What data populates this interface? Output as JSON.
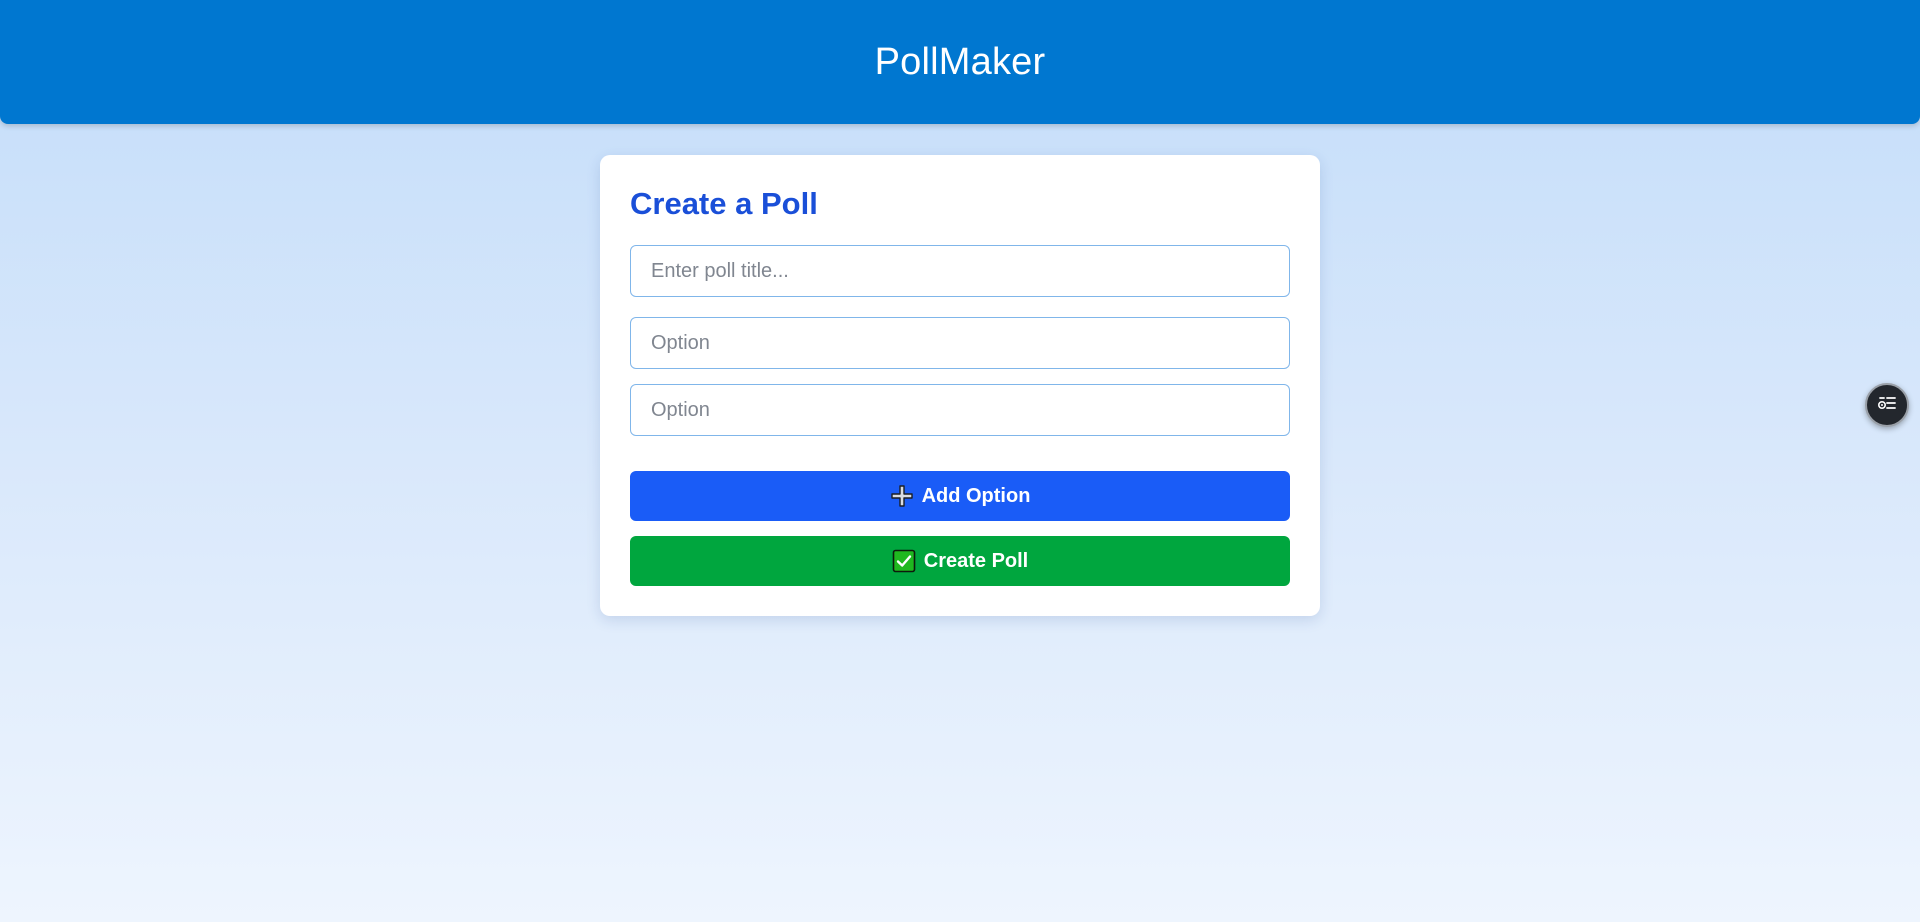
{
  "header": {
    "title": "PollMaker",
    "background_color": "#0077d0"
  },
  "form": {
    "heading": "Create a Poll",
    "title_input": {
      "placeholder": "Enter poll title...",
      "value": ""
    },
    "options": [
      {
        "placeholder": "Option",
        "value": ""
      },
      {
        "placeholder": "Option",
        "value": ""
      }
    ],
    "add_option_button": {
      "label": "Add Option",
      "icon": "plus-icon",
      "color": "#1a5cf7"
    },
    "create_poll_button": {
      "label": "Create Poll",
      "icon": "check-box-icon",
      "color": "#00a63e"
    }
  },
  "floating_button": {
    "icon": "accessibility-menu-icon"
  },
  "colors": {
    "accent_heading": "#1a4fd8",
    "page_background_top": "#c3ddfa",
    "page_background_bottom": "#eef5fe"
  }
}
